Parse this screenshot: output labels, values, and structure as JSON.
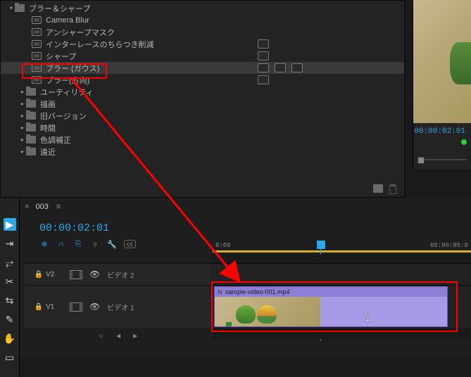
{
  "effects": {
    "group_open": "ブラー＆シャープ",
    "items": [
      {
        "label": "Camera Blur",
        "badges": 0
      },
      {
        "label": "アンシャープマスク",
        "badges": 0
      },
      {
        "label": "インターレースのちらつき削減",
        "badges": 1
      },
      {
        "label": "シャープ",
        "badges": 1
      },
      {
        "label": "ブラー (ガウス)",
        "badges": 3,
        "selected": true,
        "highlighted": true
      },
      {
        "label": "ブラー(方向)",
        "badges": 1
      }
    ],
    "folders": [
      "ユーティリティ",
      "描画",
      "旧バージョン",
      "時間",
      "色調補正",
      "遠近"
    ]
  },
  "monitor": {
    "timecode": "00:00:02:01"
  },
  "timeline": {
    "sequence_name": "003",
    "timecode": "00:00:02:01",
    "ruler": {
      "start": "0:00",
      "end": "00:00:05:0"
    },
    "tracks": {
      "v2": {
        "target": "V2",
        "name": "ビデオ 2"
      },
      "v1": {
        "target": "V1",
        "name": "ビデオ 1"
      }
    },
    "clip": {
      "name": "sample-video-001.mp4",
      "fx": "fx"
    }
  },
  "tools": [
    "select",
    "track-select",
    "ripple",
    "rolling",
    "rate",
    "slip",
    "pen",
    "hand",
    "rect"
  ]
}
